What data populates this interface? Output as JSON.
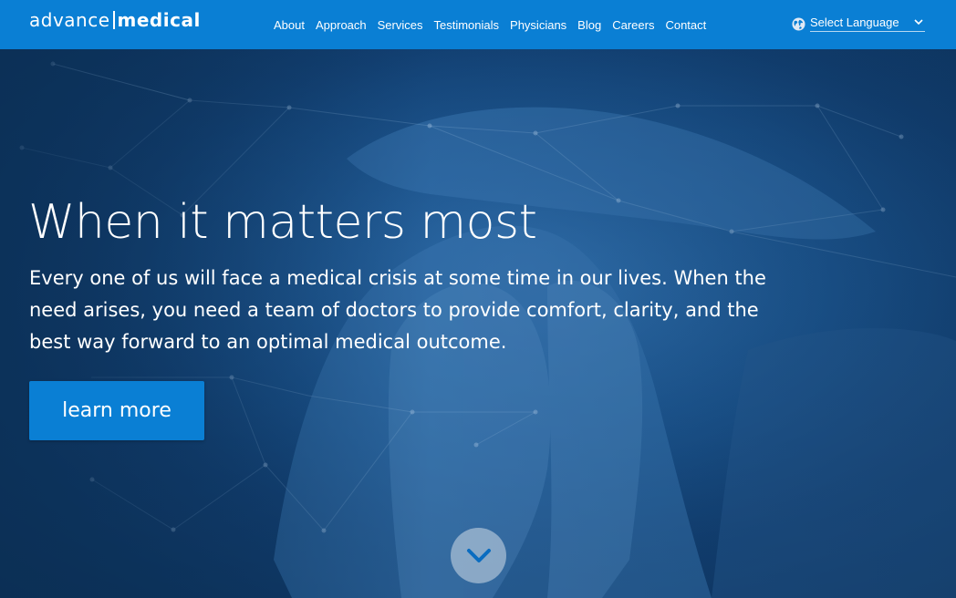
{
  "brand": {
    "logo_left": "advance",
    "logo_right": "medical"
  },
  "nav": {
    "items": [
      {
        "label": "About"
      },
      {
        "label": "Approach"
      },
      {
        "label": "Services"
      },
      {
        "label": "Testimonials"
      },
      {
        "label": "Physicians"
      },
      {
        "label": "Blog"
      },
      {
        "label": "Careers"
      },
      {
        "label": "Contact"
      }
    ]
  },
  "language": {
    "label": "Select Language",
    "icon": "globe-icon"
  },
  "hero": {
    "title": "When it matters most",
    "text": "Every one of us will face a medical crisis at some time in our lives. When the need arises, you need a team of doctors to provide comfort, clarity, and the best way forward to an optimal medical outcome.",
    "cta_label": "learn more",
    "scroll_icon": "chevron-down-icon"
  },
  "colors": {
    "header_bg": "#0a7fd4",
    "hero_tint": "#1c5590",
    "cta_bg": "#0a7fd4",
    "text": "#ffffff"
  }
}
